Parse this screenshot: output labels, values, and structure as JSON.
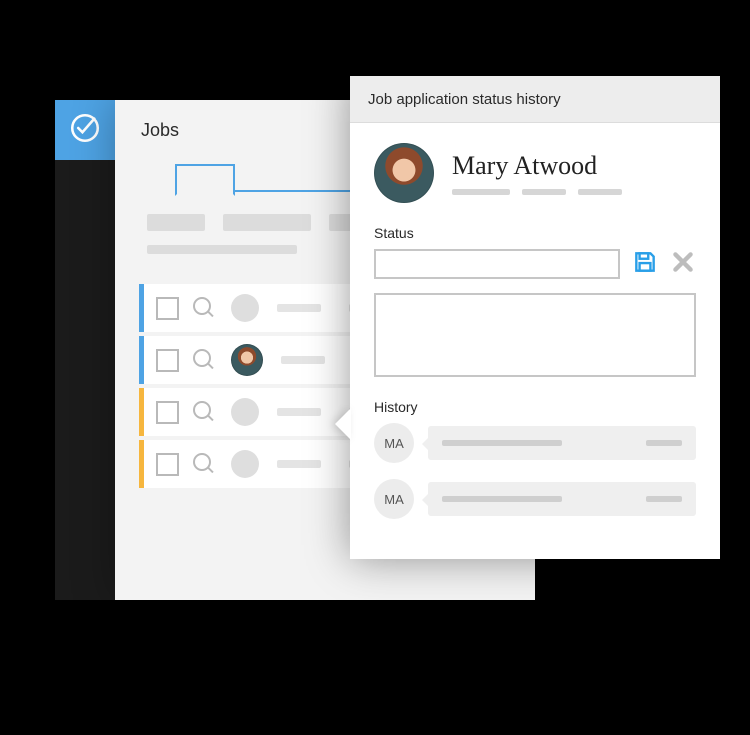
{
  "sidebar": {
    "logo_icon": "check-circle-icon"
  },
  "jobs": {
    "title": "Jobs",
    "rows": [
      {
        "indicator": "blue",
        "selected": false
      },
      {
        "indicator": "blue",
        "selected": true
      },
      {
        "indicator": "amber",
        "selected": false
      },
      {
        "indicator": "amber",
        "selected": false
      }
    ]
  },
  "popover": {
    "title": "Job application status history",
    "applicant": {
      "name": "Mary Atwood",
      "initials": "MA"
    },
    "status": {
      "label": "Status",
      "value": ""
    },
    "history": {
      "label": "History",
      "items": [
        {
          "initials": "MA"
        },
        {
          "initials": "MA"
        }
      ]
    },
    "actions": {
      "save_icon": "save-icon",
      "cancel_icon": "close-icon"
    }
  }
}
